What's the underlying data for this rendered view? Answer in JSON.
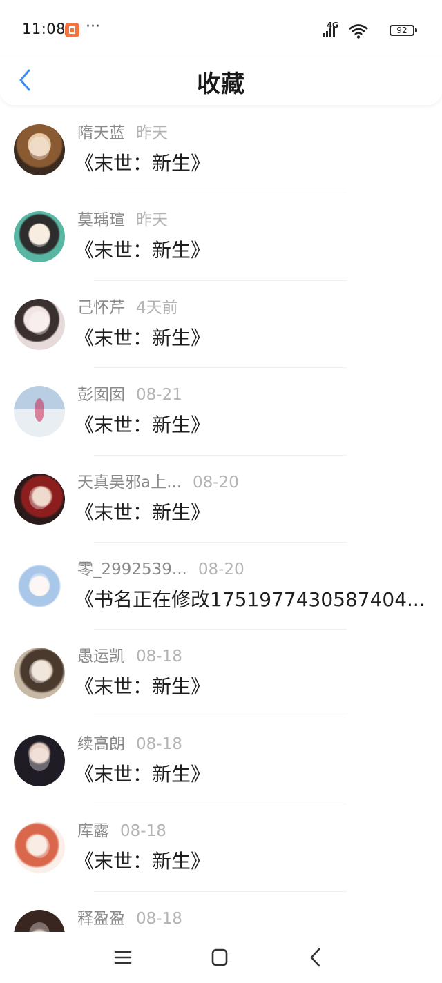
{
  "status_bar": {
    "time": "11:08",
    "more": "···",
    "network": "4G",
    "battery": "92",
    "icons": [
      "app-notification-icon",
      "signal-icon",
      "wifi-icon",
      "battery-icon"
    ]
  },
  "header": {
    "title": "收藏",
    "back_icon": "chevron-left-icon",
    "accent": "#3d8df5"
  },
  "items": [
    {
      "name": "隋天蓝",
      "time": "昨天",
      "book": "《末世：新生》"
    },
    {
      "name": "莫瑀瑄",
      "time": "昨天",
      "book": "《末世：新生》"
    },
    {
      "name": "己怀芹",
      "time": "4天前",
      "book": "《末世：新生》"
    },
    {
      "name": "彭囡囡",
      "time": "08-21",
      "book": "《末世：新生》"
    },
    {
      "name": "天真吴邪a上...",
      "time": "08-20",
      "book": "《末世：新生》"
    },
    {
      "name": "零_2992539...",
      "time": "08-20",
      "book": "《书名正在修改1751977430587404..."
    },
    {
      "name": "愚运凯",
      "time": "08-18",
      "book": "《末世：新生》"
    },
    {
      "name": "续高朗",
      "time": "08-18",
      "book": "《末世：新生》"
    },
    {
      "name": "库露",
      "time": "08-18",
      "book": "《末世：新生》"
    },
    {
      "name": "释盈盈",
      "time": "08-18",
      "book": ""
    }
  ],
  "nav_bar": {
    "icons": [
      "menu-icon",
      "home-icon",
      "back-icon"
    ]
  }
}
